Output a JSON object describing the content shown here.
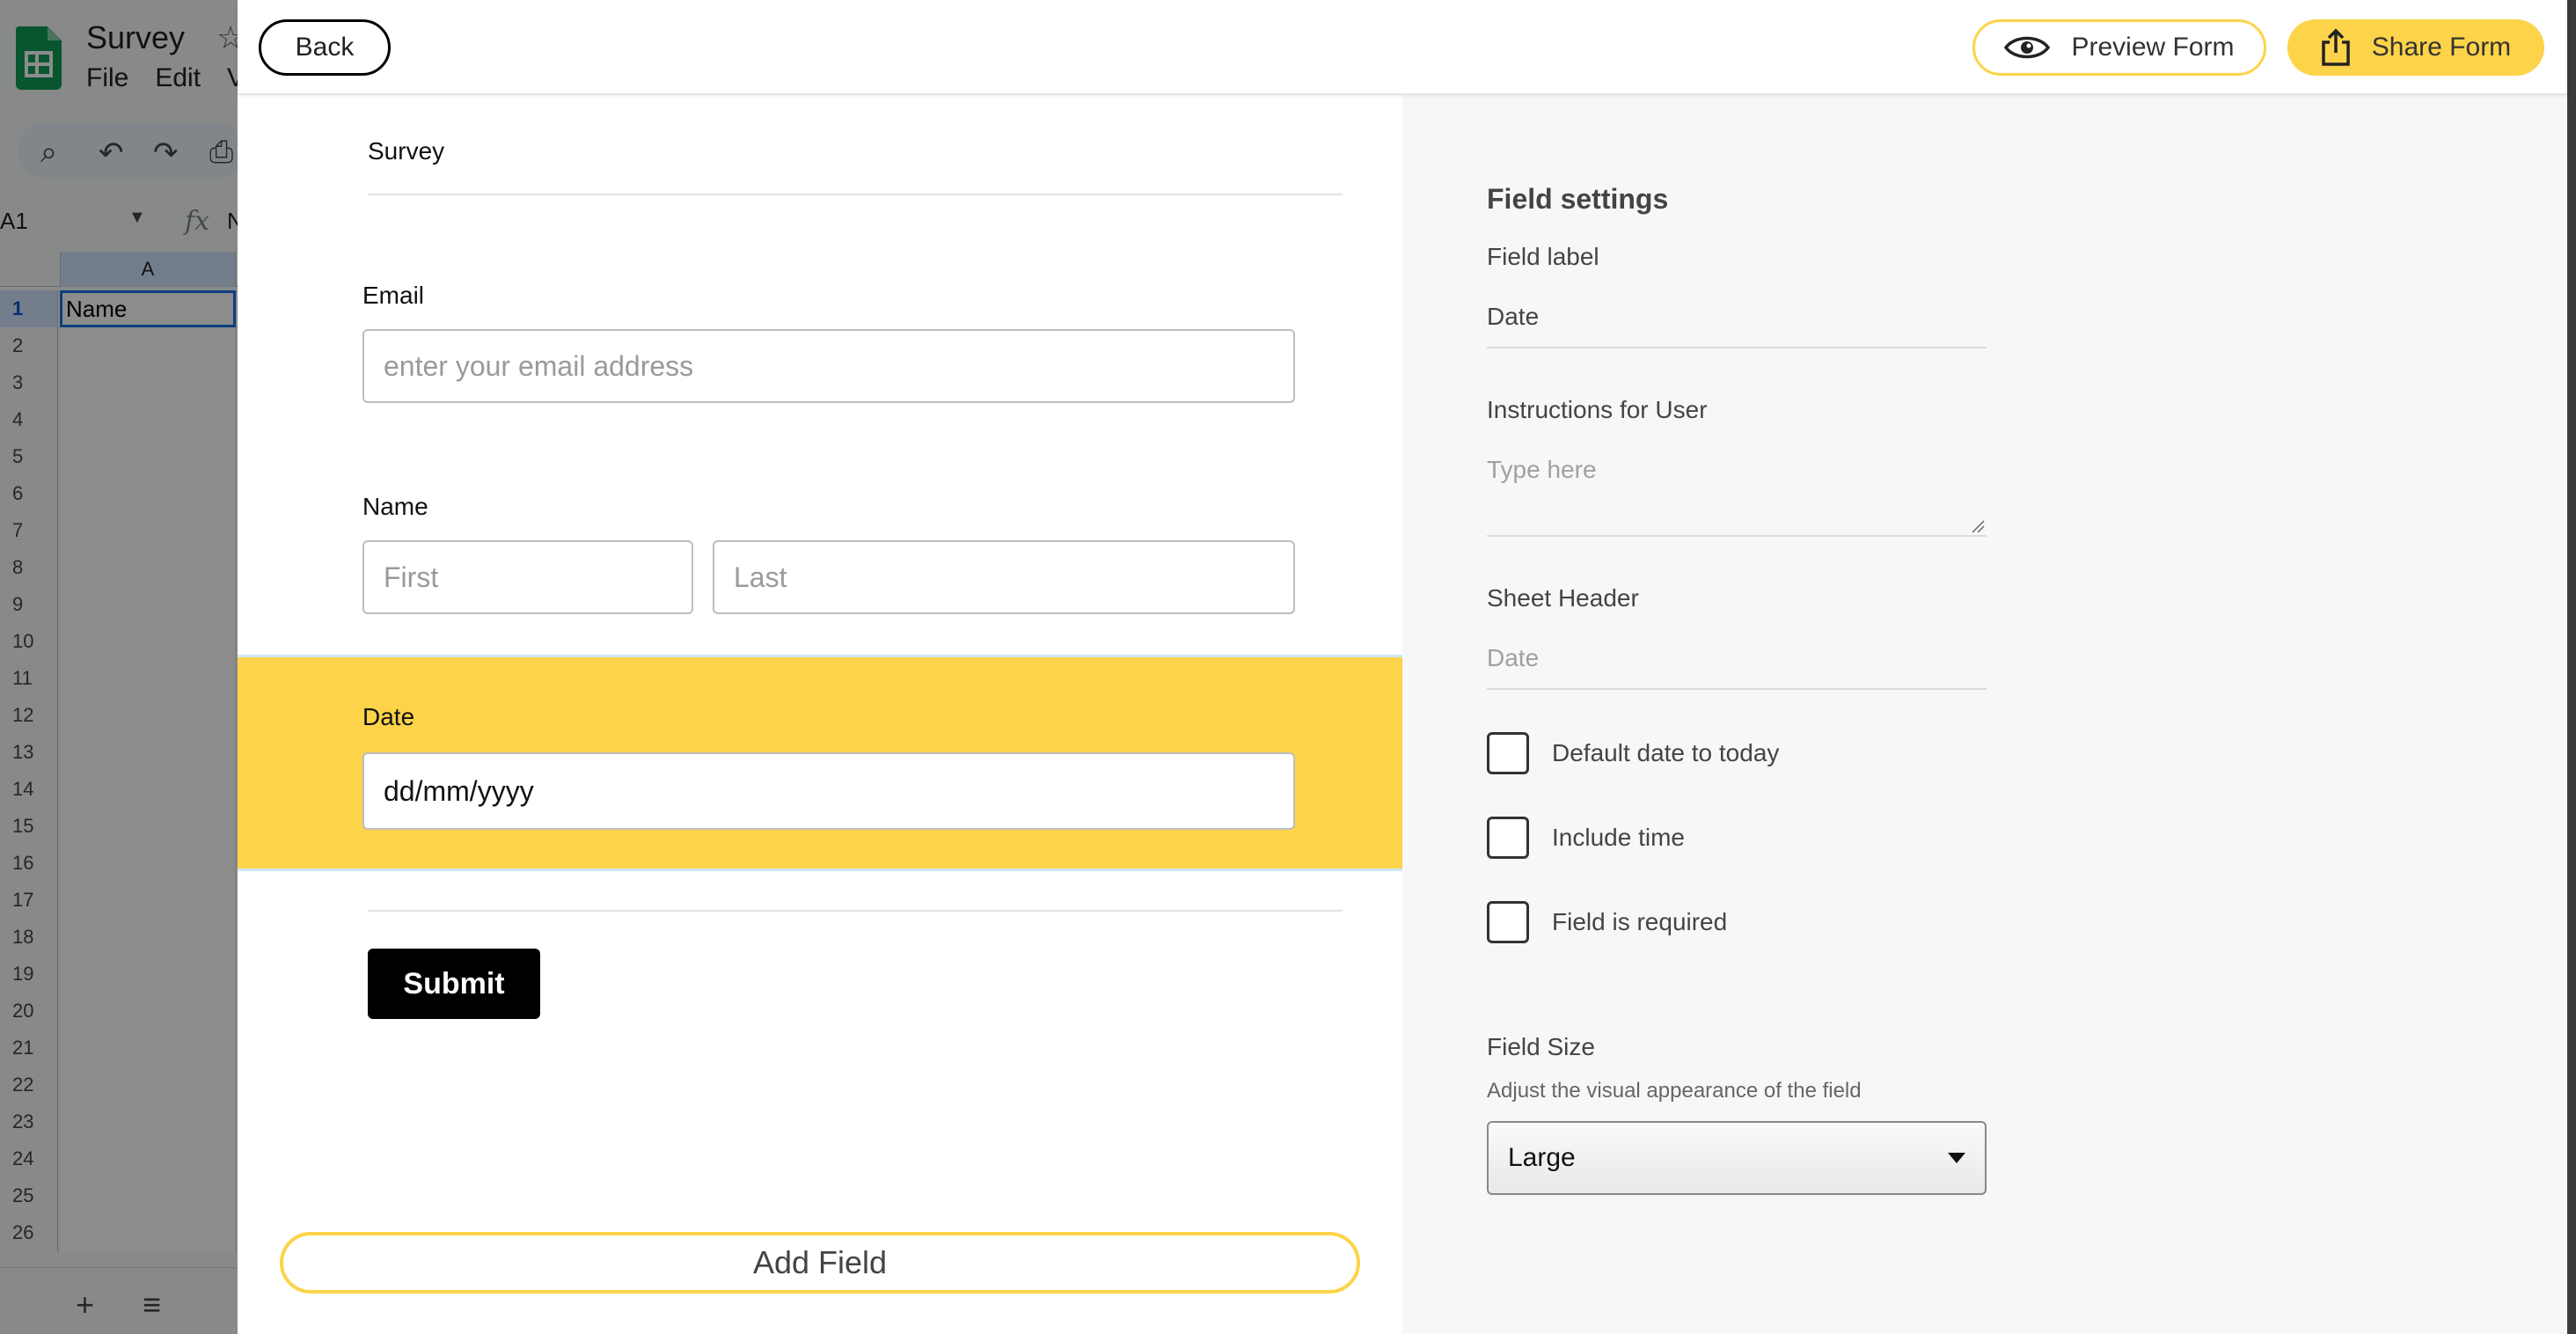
{
  "sheets": {
    "doc_title": "Survey",
    "menu": [
      "File",
      "Edit",
      "V"
    ],
    "name_box": "A1",
    "fx_text": "fx",
    "formula_partial": "N",
    "column_header": "A",
    "rows": [
      "1",
      "2",
      "3",
      "4",
      "5",
      "6",
      "7",
      "8",
      "9",
      "10",
      "11",
      "12",
      "13",
      "14",
      "15",
      "16",
      "17",
      "18",
      "19",
      "20",
      "21",
      "22",
      "23",
      "24",
      "25",
      "26"
    ],
    "cell_a1": "Name"
  },
  "topbar": {
    "back_label": "Back",
    "preview_label": "Preview Form",
    "share_label": "Share Form"
  },
  "form": {
    "title": "Survey",
    "email": {
      "label": "Email",
      "placeholder": "enter your email address"
    },
    "name": {
      "label": "Name",
      "first_placeholder": "First",
      "last_placeholder": "Last"
    },
    "date": {
      "label": "Date",
      "value": "dd/mm/yyyy"
    },
    "submit_label": "Submit",
    "add_field_label": "Add Field"
  },
  "settings": {
    "title": "Field settings",
    "field_label_label": "Field label",
    "field_label_value": "Date",
    "instructions_label": "Instructions for User",
    "instructions_placeholder": "Type here",
    "sheet_header_label": "Sheet Header",
    "sheet_header_placeholder": "Date",
    "checkboxes": [
      {
        "label": "Default date to today",
        "checked": false
      },
      {
        "label": "Include time",
        "checked": false
      },
      {
        "label": "Field is required",
        "checked": false
      }
    ],
    "field_size_label": "Field Size",
    "field_size_hint": "Adjust the visual appearance of the field",
    "field_size_value": "Large"
  },
  "colors": {
    "accent_yellow": "#fdd349",
    "selection_band": "#fdd349",
    "submit_bg": "#000000",
    "sheets_green": "#0f9d58"
  },
  "icons": {
    "preview": "eye-icon",
    "share": "share-upload-icon",
    "sheets": "google-sheets-logo"
  }
}
